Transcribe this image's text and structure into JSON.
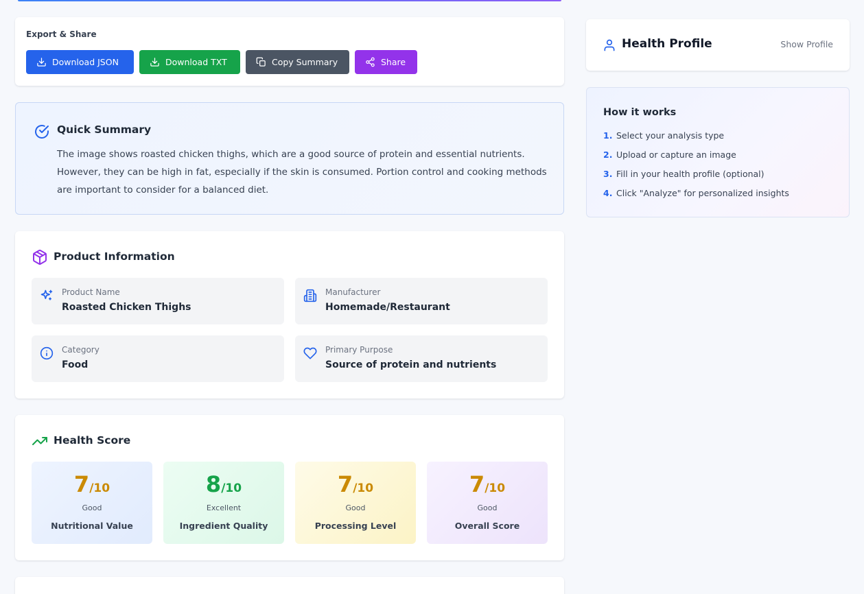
{
  "export": {
    "title": "Export & Share",
    "buttons": [
      {
        "label": "Download JSON",
        "icon": "download-icon",
        "color": "#2563eb"
      },
      {
        "label": "Download TXT",
        "icon": "download-icon",
        "color": "#16a34a"
      },
      {
        "label": "Copy Summary",
        "icon": "copy-icon",
        "color": "#4b5563"
      },
      {
        "label": "Share",
        "icon": "share-icon",
        "color": "#9333ea"
      }
    ]
  },
  "summary": {
    "title": "Quick Summary",
    "text": "The image shows roasted chicken thighs, which are a good source of protein and essential nutrients. However, they can be high in fat, especially if the skin is consumed. Portion control and cooking methods are important to consider for a balanced diet."
  },
  "product": {
    "title": "Product Information",
    "fields": [
      {
        "label": "Product Name",
        "value": "Roasted Chicken Thighs",
        "icon": "sparkles-icon"
      },
      {
        "label": "Manufacturer",
        "value": "Homemade/Restaurant",
        "icon": "building-icon"
      },
      {
        "label": "Category",
        "value": "Food",
        "icon": "info-icon"
      },
      {
        "label": "Primary Purpose",
        "value": "Source of protein and nutrients",
        "icon": "heart-icon"
      }
    ]
  },
  "health": {
    "title": "Health Score",
    "scores": [
      {
        "value": "7",
        "denominator": "/10",
        "rating": "Good",
        "label": "Nutritional Value",
        "color": "#ca8a04"
      },
      {
        "value": "8",
        "denominator": "/10",
        "rating": "Excellent",
        "label": "Ingredient Quality",
        "color": "#16a34a"
      },
      {
        "value": "7",
        "denominator": "/10",
        "rating": "Good",
        "label": "Processing Level",
        "color": "#ca8a04"
      },
      {
        "value": "7",
        "denominator": "/10",
        "rating": "Good",
        "label": "Overall Score",
        "color": "#ca8a04"
      }
    ]
  },
  "profile": {
    "title": "Health Profile",
    "toggle_label": "Show Profile"
  },
  "how": {
    "title": "How it works",
    "steps": [
      {
        "num": "1.",
        "text": "Select your analysis type"
      },
      {
        "num": "2.",
        "text": "Upload or capture an image"
      },
      {
        "num": "3.",
        "text": "Fill in your health profile (optional)"
      },
      {
        "num": "4.",
        "text": "Click \"Analyze\" for personalized insights"
      }
    ]
  },
  "colors": {
    "primary": "#2563eb",
    "success": "#16a34a",
    "warning": "#ca8a04",
    "purple": "#9333ea"
  }
}
